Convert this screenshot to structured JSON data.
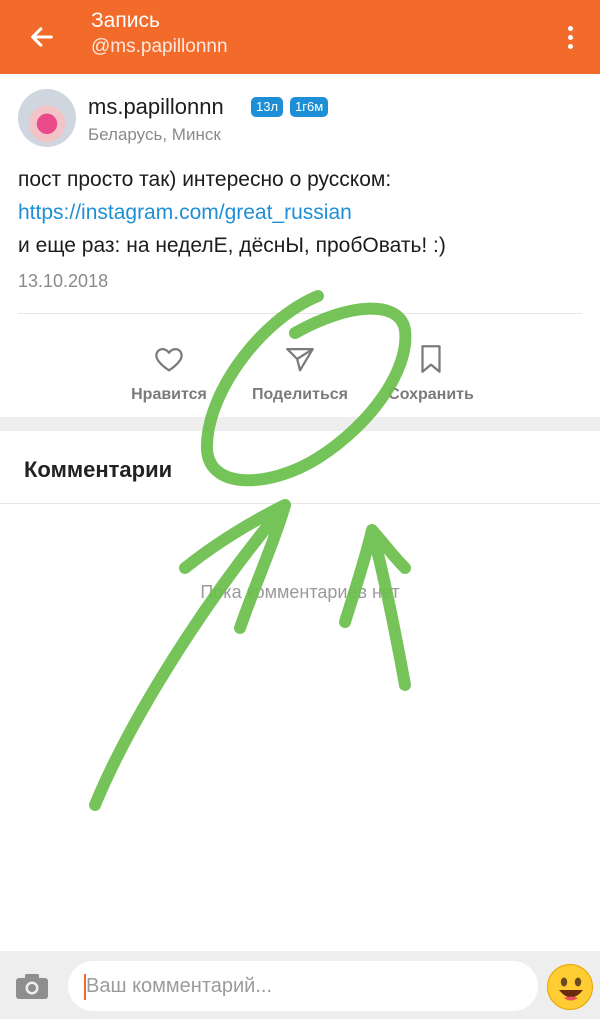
{
  "appbar": {
    "title": "Запись",
    "subtitle": "@ms.papillonnn",
    "back_icon": "arrow-left-icon",
    "menu_icon": "more-vertical-icon",
    "color": "#f26b2b"
  },
  "author": {
    "name": "ms.papillonnn",
    "badges": [
      "13л",
      "1г6м"
    ],
    "location": "Беларусь, Минск"
  },
  "post": {
    "line1": "пост просто так) интересно о русском:",
    "link": "https://instagram.com/great_russian",
    "line3": "и еще раз: на неделЕ, дёснЫ, пробОвать! :)",
    "date": "13.10.2018"
  },
  "actions": {
    "like": "Нравится",
    "share": "Поделиться",
    "save": "Сохранить"
  },
  "comments": {
    "title": "Комментарии",
    "empty_text": "Пока комментариев нет"
  },
  "composer": {
    "placeholder": "Ваш комментарий...",
    "camera_icon": "camera-icon",
    "emoji_icon": "emoji-smile-icon"
  },
  "colors": {
    "accent": "#f26b2b",
    "link": "#1e8fd6",
    "annotation": "#6abf4b"
  }
}
